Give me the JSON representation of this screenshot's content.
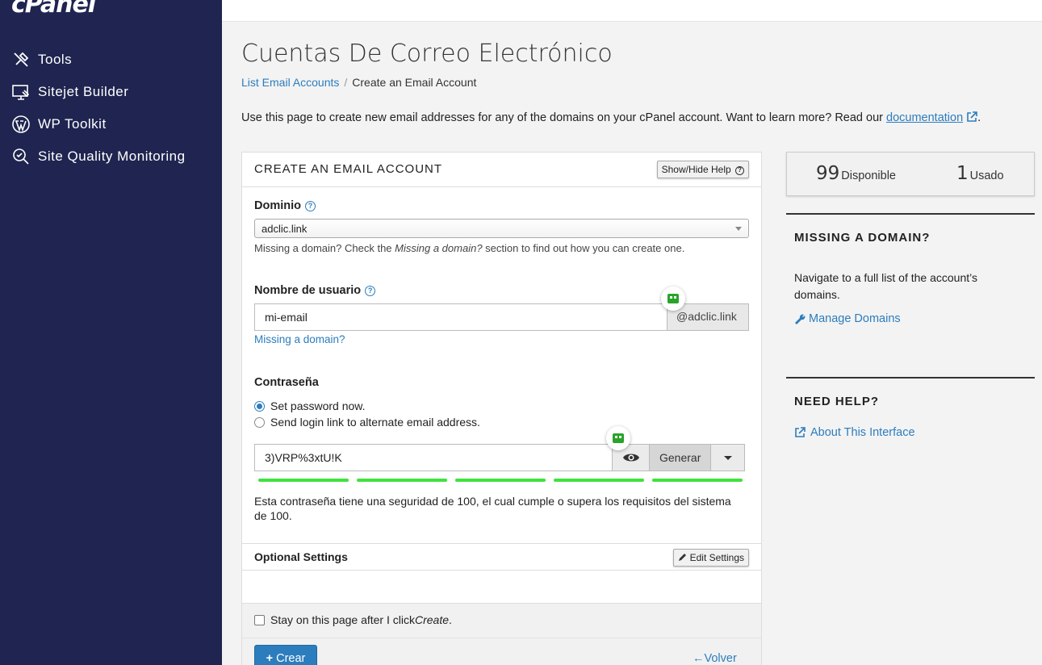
{
  "sidebar": {
    "logo": "cPanel",
    "items": [
      {
        "label": "Tools",
        "icon": "tools-icon"
      },
      {
        "label": "Sitejet Builder",
        "icon": "sitejet-icon"
      },
      {
        "label": "WP Toolkit",
        "icon": "wordpress-icon"
      },
      {
        "label": "Site Quality Monitoring",
        "icon": "site-quality-icon"
      }
    ]
  },
  "page": {
    "title": "Cuentas De Correo Electrónico",
    "breadcrumb": {
      "parent": "List Email Accounts",
      "sep": "/",
      "current": "Create an Email Account"
    },
    "intro_text": "Use this page to create new email addresses for any of the domains on your cPanel account. Want to learn more? Read our ",
    "intro_link": "documentation",
    "intro_end": "."
  },
  "form": {
    "panel_title": "CREATE AN EMAIL ACCOUNT",
    "help_toggle": "Show/Hide Help",
    "domain_label": "Dominio",
    "domain_value": "adclic.link",
    "domain_help_pre": "Missing a domain? Check the ",
    "domain_help_em": "Missing a domain?",
    "domain_help_post": " section to find out how you can create one.",
    "username_label": "Nombre de usuario",
    "username_value": "mi-email",
    "username_suffix": "@adclic.link",
    "missing_domain_link": "Missing a domain?",
    "password_label": "Contraseña",
    "radio_set_now": "Set password now.",
    "radio_send_link": "Send login link to alternate email address.",
    "password_value": "3)VRP%3xtU!K",
    "generate_label": "Generar",
    "strength_text": "Esta contraseña tiene una seguridad de 100, el cual cumple o supera los requisitos del sistema de 100.",
    "strength_level": 1.0,
    "optional_settings": "Optional Settings",
    "edit_settings": "Edit Settings",
    "stay_pre": "Stay on this page after I click ",
    "stay_em": "Create",
    "stay_post": ".",
    "create_label": "Crear",
    "back_label": "Volver"
  },
  "stats": {
    "available_num": "99",
    "available_label": "Disponible",
    "used_num": "1",
    "used_label": "Usado"
  },
  "missing_domain": {
    "heading": "MISSING A DOMAIN?",
    "text": "Navigate to a full list of the account’s domains.",
    "link": "Manage Domains"
  },
  "need_help": {
    "heading": "NEED HELP?",
    "link": "About This Interface"
  },
  "colors": {
    "sidebar_bg": "#1f2550",
    "link": "#2c7dbd",
    "strength": "#3ee23e",
    "primary": "#2c7dbd"
  }
}
